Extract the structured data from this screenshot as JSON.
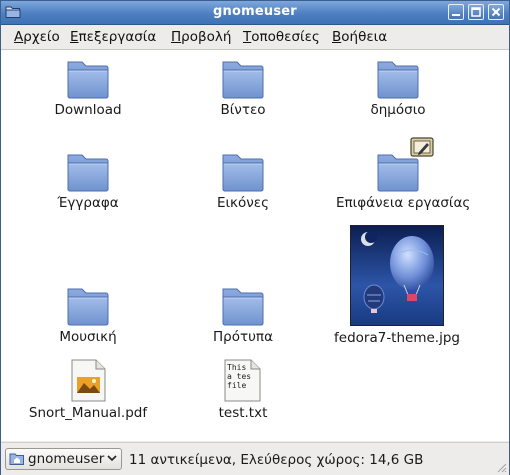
{
  "window": {
    "title": "gnomeuser"
  },
  "menubar": {
    "items": [
      {
        "label": "Αρχείο",
        "mnemonic": "Α",
        "rest": "ρχείο"
      },
      {
        "label": "Επεξεργασία",
        "mnemonic": "Ε",
        "rest": "πεξεργασία"
      },
      {
        "label": "Προβολή",
        "mnemonic": "Π",
        "rest": "ροβολή"
      },
      {
        "label": "Τοποθεσίες",
        "mnemonic": "Τ",
        "rest": "οποθεσίες"
      },
      {
        "label": "Βοήθεια",
        "mnemonic": "Β",
        "rest": "οήθεια"
      }
    ]
  },
  "files": [
    {
      "name": "Download",
      "type": "folder"
    },
    {
      "name": "Βίντεο",
      "type": "folder"
    },
    {
      "name": "δημόσιο",
      "type": "folder"
    },
    {
      "name": "Έγγραφα",
      "type": "folder"
    },
    {
      "name": "Εικόνες",
      "type": "folder"
    },
    {
      "name": "Επιφάνεια εργασίας",
      "type": "folder-desktop"
    },
    {
      "name": "Μουσική",
      "type": "folder"
    },
    {
      "name": "Πρότυπα",
      "type": "folder"
    },
    {
      "name": "fedora7-theme.jpg",
      "type": "image"
    },
    {
      "name": "Snort_Manual.pdf",
      "type": "pdf"
    },
    {
      "name": "test.txt",
      "type": "text",
      "preview": [
        "This",
        "a tes",
        "file"
      ]
    }
  ],
  "statusbar": {
    "location": "gnomeuser",
    "info": "11 αντικείμενα, Ελεύθερος χώρος: 14,6 GB"
  },
  "colors": {
    "titlebar": "#4d7fc1",
    "folder": "#7f9fd8"
  }
}
